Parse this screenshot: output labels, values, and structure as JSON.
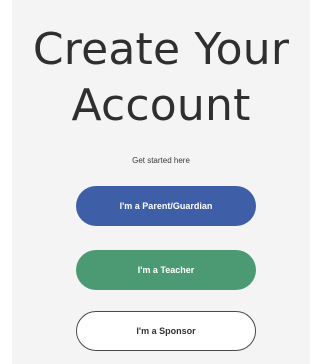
{
  "header": {
    "title_line1": "Create Your",
    "title_line2": "Account",
    "subtitle": "Get started here"
  },
  "actions": {
    "parent_label": "I'm a Parent/Guardian",
    "teacher_label": "I'm a Teacher",
    "sponsor_label": "I'm a Sponsor"
  },
  "colors": {
    "parent_button": "#3f5ea8",
    "teacher_button": "#4b9a73",
    "sponsor_border": "#4a4a4a"
  }
}
